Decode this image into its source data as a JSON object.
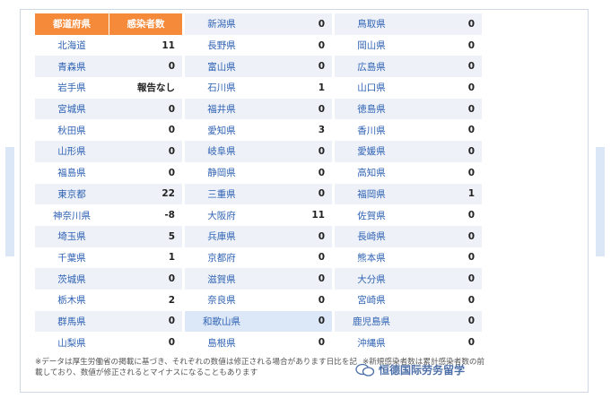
{
  "header": {
    "prefecture_label": "都道府県",
    "cases_label": "感染者数"
  },
  "columns": [
    [
      {
        "name": "北海道",
        "value": "11",
        "style": ""
      },
      {
        "name": "青森県",
        "value": "0",
        "style": "shade"
      },
      {
        "name": "岩手県",
        "value": "報告なし",
        "style": ""
      },
      {
        "name": "宮城県",
        "value": "0",
        "style": "shade"
      },
      {
        "name": "秋田県",
        "value": "0",
        "style": ""
      },
      {
        "name": "山形県",
        "value": "0",
        "style": "shade"
      },
      {
        "name": "福島県",
        "value": "0",
        "style": ""
      },
      {
        "name": "東京都",
        "value": "22",
        "style": "shade"
      },
      {
        "name": "神奈川県",
        "value": "-8",
        "style": ""
      },
      {
        "name": "埼玉県",
        "value": "5",
        "style": "shade"
      },
      {
        "name": "千葉県",
        "value": "1",
        "style": ""
      },
      {
        "name": "茨城県",
        "value": "0",
        "style": "shade"
      },
      {
        "name": "栃木県",
        "value": "2",
        "style": ""
      },
      {
        "name": "群馬県",
        "value": "0",
        "style": "shade"
      },
      {
        "name": "山梨県",
        "value": "0",
        "style": ""
      }
    ],
    [
      {
        "name": "新潟県",
        "value": "0",
        "style": "shade"
      },
      {
        "name": "長野県",
        "value": "0",
        "style": ""
      },
      {
        "name": "富山県",
        "value": "0",
        "style": "shade"
      },
      {
        "name": "石川県",
        "value": "1",
        "style": ""
      },
      {
        "name": "福井県",
        "value": "0",
        "style": "shade"
      },
      {
        "name": "愛知県",
        "value": "3",
        "style": ""
      },
      {
        "name": "岐阜県",
        "value": "0",
        "style": "shade"
      },
      {
        "name": "静岡県",
        "value": "0",
        "style": ""
      },
      {
        "name": "三重県",
        "value": "0",
        "style": "shade"
      },
      {
        "name": "大阪府",
        "value": "11",
        "style": ""
      },
      {
        "name": "兵庫県",
        "value": "0",
        "style": "shade"
      },
      {
        "name": "京都府",
        "value": "0",
        "style": ""
      },
      {
        "name": "滋賀県",
        "value": "0",
        "style": "shade"
      },
      {
        "name": "奈良県",
        "value": "0",
        "style": ""
      },
      {
        "name": "和歌山県",
        "value": "0",
        "style": "hl"
      },
      {
        "name": "島根県",
        "value": "0",
        "style": ""
      }
    ],
    [
      {
        "name": "鳥取県",
        "value": "0",
        "style": "shade"
      },
      {
        "name": "岡山県",
        "value": "0",
        "style": ""
      },
      {
        "name": "広島県",
        "value": "0",
        "style": "shade"
      },
      {
        "name": "山口県",
        "value": "0",
        "style": ""
      },
      {
        "name": "徳島県",
        "value": "0",
        "style": "shade"
      },
      {
        "name": "香川県",
        "value": "0",
        "style": ""
      },
      {
        "name": "愛媛県",
        "value": "0",
        "style": "shade"
      },
      {
        "name": "高知県",
        "value": "0",
        "style": ""
      },
      {
        "name": "福岡県",
        "value": "1",
        "style": "shade"
      },
      {
        "name": "佐賀県",
        "value": "0",
        "style": ""
      },
      {
        "name": "長崎県",
        "value": "0",
        "style": "shade"
      },
      {
        "name": "熊本県",
        "value": "0",
        "style": ""
      },
      {
        "name": "大分県",
        "value": "0",
        "style": "shade"
      },
      {
        "name": "宮崎県",
        "value": "0",
        "style": ""
      },
      {
        "name": "鹿児島県",
        "value": "0",
        "style": "shade"
      },
      {
        "name": "沖縄県",
        "value": "0",
        "style": ""
      }
    ]
  ],
  "footnote": "※データは厚生労働省の掲載に基づき、それぞれの数値は修正される場合があります日比を記載しており、数値が修正されるとマイナスになることもあります",
  "footnote_right": "※新規感染者数は累計感染者数の前",
  "watermark": "恒德国际劳务留学",
  "colors": {
    "header_bg": "#f58b3a",
    "link": "#2f62b3",
    "row_shade": "#eef2f8",
    "row_highlight": "#dce8f8"
  }
}
